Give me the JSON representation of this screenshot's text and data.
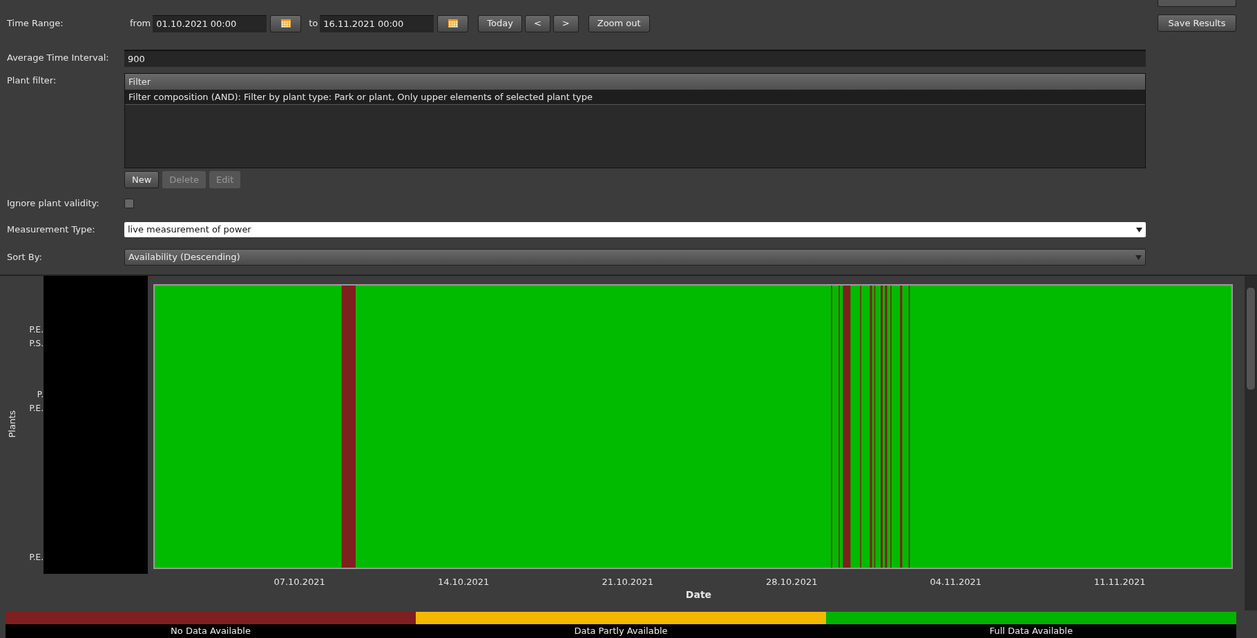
{
  "time_range": {
    "label": "Time Range:",
    "from_label": "from",
    "from_value": "01.10.2021 00:00",
    "to_label": "to",
    "to_value": "16.11.2021 00:00",
    "buttons": [
      "Today",
      "<",
      ">",
      "Zoom out"
    ]
  },
  "save_button": "Save Results",
  "average_interval": {
    "label": "Average Time Interval:",
    "value": "900"
  },
  "plant_filter": {
    "label": "Plant filter:",
    "header": "Filter",
    "rows": [
      {
        "text": "Filter composition (AND): Filter by plant type: Park or plant, Only upper elements of selected plant type",
        "selected": true
      }
    ],
    "buttons": [
      {
        "label": "New",
        "disabled": false
      },
      {
        "label": "Delete",
        "disabled": true
      },
      {
        "label": "Edit",
        "disabled": true
      }
    ]
  },
  "ignore_validity": {
    "label": "Ignore plant validity:",
    "checked": false
  },
  "measurement_type": {
    "label": "Measurement Type:",
    "value": "live measurement of power"
  },
  "sort_by": {
    "label": "Sort By:",
    "value": "Availability (Descending)"
  },
  "chart": {
    "ylabel": "Plants",
    "xlabel": "Date",
    "ytick_labels": [
      "P.E.",
      "P.S.",
      "P.",
      "P.E.",
      "P.E."
    ],
    "xtick_labels": [
      "07.10.2021",
      "14.10.2021",
      "21.10.2021",
      "28.10.2021",
      "04.11.2021",
      "11.11.2021"
    ]
  },
  "legend": [
    {
      "label": "No Data Available",
      "color": "#7f1f1f"
    },
    {
      "label": "Data Partly Available",
      "color": "#f5b800"
    },
    {
      "label": "Full Data Available",
      "color": "#00b400"
    }
  ]
}
